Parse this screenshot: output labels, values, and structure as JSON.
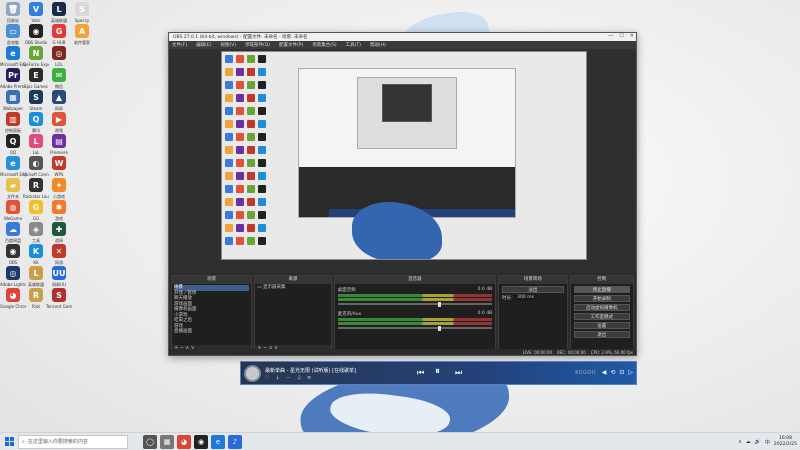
{
  "desktop": {
    "icons": [
      {
        "label": "回收站",
        "glyph": "🗑",
        "color": "#8fa7c6"
      },
      {
        "label": "Vote",
        "glyph": "V",
        "color": "#2f7fe1"
      },
      {
        "label": "英雄联盟",
        "glyph": "L",
        "color": "#1a2b4a"
      },
      {
        "label": "Speccy",
        "glyph": "S",
        "color": "#d8d8d8"
      },
      {
        "label": "此电脑",
        "glyph": "▭",
        "color": "#4a8fd8"
      },
      {
        "label": "OBS Studio",
        "glyph": "◉",
        "color": "#222"
      },
      {
        "label": "G HUB",
        "glyph": "G",
        "color": "#e13b3b"
      },
      {
        "label": "软件管家",
        "glyph": "A",
        "color": "#f0a33a"
      },
      {
        "label": "Microsoft Edge",
        "glyph": "e",
        "color": "#1d7ad8"
      },
      {
        "label": "GeForce Experience",
        "glyph": "N",
        "color": "#69a436"
      },
      {
        "label": "LOL",
        "glyph": "◎",
        "color": "#7a2a20"
      },
      {
        "label": "",
        "glyph": "",
        "color": "transparent"
      },
      {
        "label": "Adobe Premiere",
        "glyph": "Pr",
        "color": "#2a1a5a"
      },
      {
        "label": "Epic Games",
        "glyph": "E",
        "color": "#2a2a2a"
      },
      {
        "label": "微信",
        "glyph": "✉",
        "color": "#3cb043"
      },
      {
        "label": "",
        "glyph": "",
        "color": "transparent"
      },
      {
        "label": "Wallpaper",
        "glyph": "▦",
        "color": "#3a70b0"
      },
      {
        "label": "Steam",
        "glyph": "S",
        "color": "#1a3a5a"
      },
      {
        "label": "网易",
        "glyph": "▲",
        "color": "#2a4a7a"
      },
      {
        "label": "",
        "glyph": "",
        "color": "transparent"
      },
      {
        "label": "控制面板",
        "glyph": "▥",
        "color": "#c0392b"
      },
      {
        "label": "腾讯",
        "glyph": "Q",
        "color": "#1a8fe0"
      },
      {
        "label": "视频",
        "glyph": "▶",
        "color": "#e0533a"
      },
      {
        "label": "",
        "glyph": "",
        "color": "transparent"
      },
      {
        "label": "QQ",
        "glyph": "Q",
        "color": "#222"
      },
      {
        "label": "LoL",
        "glyph": "L",
        "color": "#e34d7a"
      },
      {
        "label": "Premiere",
        "glyph": "▤",
        "color": "#6a2fa0"
      },
      {
        "label": "",
        "glyph": "",
        "color": "transparent"
      },
      {
        "label": "Microsoft Edge",
        "glyph": "e",
        "color": "#2a8fd8"
      },
      {
        "label": "Ubisoft Connect",
        "glyph": "◐",
        "color": "#555"
      },
      {
        "label": "WPS",
        "glyph": "W",
        "color": "#c0392b"
      },
      {
        "label": "",
        "glyph": "",
        "color": "transparent"
      },
      {
        "label": "文件夹",
        "glyph": "▰",
        "color": "#e8c04a"
      },
      {
        "label": "Rockstar Launcher",
        "glyph": "R",
        "color": "#333"
      },
      {
        "label": "小游戏",
        "glyph": "✦",
        "color": "#f08a2a"
      },
      {
        "label": "",
        "glyph": "",
        "color": "transparent"
      },
      {
        "label": "WeGame",
        "glyph": "◍",
        "color": "#e0533a"
      },
      {
        "label": "GG",
        "glyph": "G",
        "color": "#f0c02a"
      },
      {
        "label": "游戏",
        "glyph": "✱",
        "color": "#f07a2a"
      },
      {
        "label": "",
        "glyph": "",
        "color": "transparent"
      },
      {
        "label": "百度网盘",
        "glyph": "☁",
        "color": "#3a7ad8"
      },
      {
        "label": "工具",
        "glyph": "◈",
        "color": "#8a8a8a"
      },
      {
        "label": "战网",
        "glyph": "✚",
        "color": "#1a5a3a"
      },
      {
        "label": "",
        "glyph": "",
        "color": "transparent"
      },
      {
        "label": "OBS",
        "glyph": "◉",
        "color": "#333"
      },
      {
        "label": "KK",
        "glyph": "K",
        "color": "#1a8fd8"
      },
      {
        "label": "网游",
        "glyph": "✕",
        "color": "#c0392b"
      },
      {
        "label": "",
        "glyph": "",
        "color": "transparent"
      },
      {
        "label": "Adobe Lightroom",
        "glyph": "◎",
        "color": "#1a3a6a"
      },
      {
        "label": "英雄联盟",
        "glyph": "L",
        "color": "#c8a04a"
      },
      {
        "label": "网易UU",
        "glyph": "UU",
        "color": "#2a6ad8"
      },
      {
        "label": "",
        "glyph": "",
        "color": "transparent"
      },
      {
        "label": "Google Chrome",
        "glyph": "◕",
        "color": "#db4437"
      },
      {
        "label": "Riot",
        "glyph": "R",
        "color": "#c8a04a"
      },
      {
        "label": "Tencent Games",
        "glyph": "S",
        "color": "#b03030"
      }
    ]
  },
  "obs": {
    "title": "OBS 27.0.1 (64-bit, windows) - 配置文件: 未命名 - 场景: 未命名",
    "window_controls": [
      "—",
      "☐",
      "✕"
    ],
    "menu": [
      "文件(F)",
      "编辑(E)",
      "视图(V)",
      "停靠部件(D)",
      "配置文件(P)",
      "场景集合(S)",
      "工具(T)",
      "帮助(H)"
    ],
    "scene_tab": "来源属性",
    "scene_filters": [
      "滤镜"
    ],
    "docks": {
      "scenes": {
        "title": "场景",
        "items": [
          "场景",
          "开场 / 暂停",
          "聊天播放",
          "游戏画面",
          "摄像机画面",
          "小游戏",
          "结束之后",
          "游戏",
          "直播画面"
        ]
      },
      "sources": {
        "title": "来源",
        "items": [
          "显示器采集"
        ]
      },
      "mixer": {
        "title": "混音器",
        "rows": [
          {
            "label": "桌面音频",
            "db": "0.0 dB"
          },
          {
            "label": "麦克风/Aux",
            "db": "0.0 dB"
          }
        ]
      },
      "transitions": {
        "title": "场景转场",
        "fade": "淡出",
        "duration_label": "时长",
        "duration": "300 ms"
      },
      "controls": {
        "title": "控制",
        "buttons": [
          "停止直播",
          "开始录制",
          "启动虚拟摄像机",
          "工作室模式",
          "设置",
          "退出"
        ]
      }
    },
    "footer_symbols": "+ − ∧ ∨",
    "status": [
      "LIVE: 00:00:00",
      "REC: 00:00:00",
      "CPU: 2.9%, 60.00 fps"
    ]
  },
  "player": {
    "song": "最新单曲 - 星光无限 (试听版) [在线歌单]",
    "sub": [
      "♡",
      "↓",
      "⋯",
      "♫",
      "≡"
    ],
    "brand": "KUGOU",
    "prev": "⏮",
    "pause": "⏸",
    "next": "⏭",
    "tools": [
      "◀",
      "⟲",
      "⊡",
      "▷"
    ]
  },
  "taskbar": {
    "search_placeholder": "在这里输入你要搜索的内容",
    "apps": [
      {
        "glyph": "◯",
        "color": "#555"
      },
      {
        "glyph": "▦",
        "color": "#777"
      },
      {
        "glyph": "◕",
        "color": "#db4437"
      },
      {
        "glyph": "◉",
        "color": "#222"
      },
      {
        "glyph": "e",
        "color": "#1d7ad8"
      },
      {
        "glyph": "♪",
        "color": "#2a6ad8"
      }
    ],
    "tray": [
      "∧",
      "☁",
      "🔊",
      "中"
    ],
    "time": "16:08",
    "date": "2022/2/25"
  },
  "colors": {
    "obs_bg": "#2b2b2b",
    "accent": "#3e5f8a",
    "player_blue": "#1e5aa6"
  }
}
